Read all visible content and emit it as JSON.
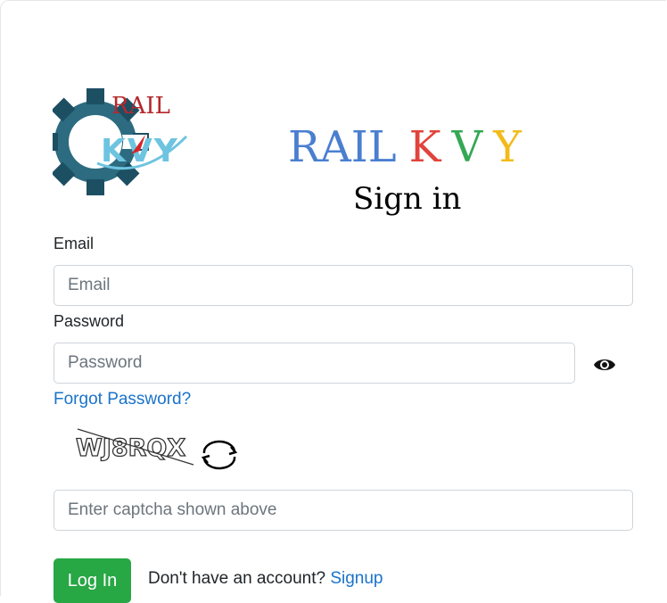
{
  "brand": {
    "logo_text_top": "RAIL",
    "logo_text_bottom": "KVY",
    "title_parts": [
      "RAIL",
      "K",
      "V",
      "Y"
    ],
    "colors": {
      "rail": "#4a7fd0",
      "k": "#e0443c",
      "v": "#34a853",
      "y": "#f2bb1a"
    }
  },
  "heading": "Sign in",
  "email": {
    "label": "Email",
    "placeholder": "Email",
    "value": ""
  },
  "password": {
    "label": "Password",
    "placeholder": "Password",
    "value": "",
    "toggle_icon": "eye-icon"
  },
  "forgot_link": "Forgot Password?",
  "captcha": {
    "code": "WJ8RQX",
    "refresh_icon": "refresh-icon",
    "placeholder": "Enter captcha shown above",
    "value": ""
  },
  "login_button": "Log In",
  "signup": {
    "prompt": "Don't have an account?",
    "link": "Signup"
  },
  "accent_colors": {
    "button": "#28a745",
    "link": "#1a73c9"
  }
}
